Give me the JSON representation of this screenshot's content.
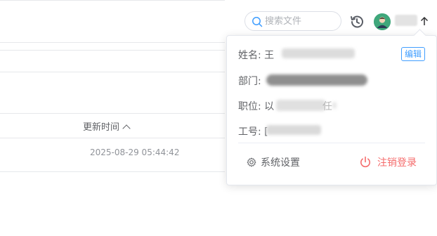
{
  "search": {
    "placeholder": "搜索文件"
  },
  "table": {
    "column_updated": "更新时间",
    "rows": [
      {
        "updated": "2025-08-29 05:44:42"
      }
    ]
  },
  "user_menu": {
    "name_label": "姓名: 王",
    "edit_label": "编辑",
    "dept_label": "部门:",
    "position_label": "职位: 以",
    "position_tail": "任",
    "employee_id_label": "工号: [",
    "settings_label": "系统设置",
    "logout_label": "注销登录"
  },
  "colors": {
    "accent": "#409eff",
    "danger": "#f56c6c",
    "avatar_bg": "#3fa77b"
  },
  "icons": [
    "search-icon",
    "history-icon",
    "avatar",
    "arrow-up-icon",
    "gear-icon",
    "power-icon",
    "sort-caret-icon"
  ]
}
